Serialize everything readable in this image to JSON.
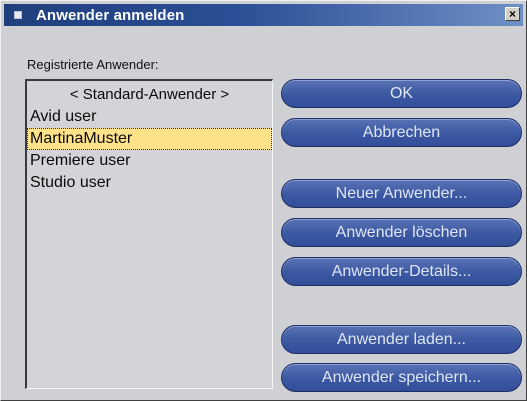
{
  "window": {
    "title": "Anwender anmelden",
    "close_label": "×",
    "icon": "window-menu-icon"
  },
  "list": {
    "label": "Registrierte Anwender:",
    "items": [
      "< Standard-Anwender >",
      "Avid user",
      "MartinaMuster",
      "Premiere user",
      "Studio user"
    ],
    "selected": "MartinaMuster"
  },
  "buttons": {
    "ok": "OK",
    "cancel": "Abbrechen",
    "new_user": "Neuer Anwender...",
    "delete_user": "Anwender löschen",
    "user_details": "Anwender-Details...",
    "load_user": "Anwender laden...",
    "save_user": "Anwender speichern..."
  },
  "colors": {
    "title_bar": "#2b4f96",
    "button": "#3d5aa4",
    "selection": "#fde28a",
    "panel": "#cfd0d4"
  }
}
